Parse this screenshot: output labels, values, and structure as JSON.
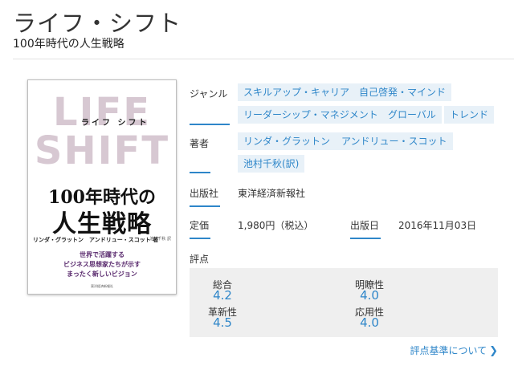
{
  "header": {
    "title": "ライフ・シフト",
    "subtitle": "100年時代の人生戦略"
  },
  "cover": {
    "big_line1": "LIFE",
    "big_line2": "SHIFT",
    "small_title": "ライフ シフト",
    "main_line1": "100年時代の",
    "main_line2": "人生戦略",
    "authors": "リンダ・グラットン　アンドリュー・スコット 著",
    "translator": "池村千秋 訳",
    "tagline1": "世界で活躍する",
    "tagline2": "ビジネス思想家たちが示す",
    "tagline3": "まったく新しいビジョン",
    "publisher_mark": "東洋経済新報社"
  },
  "details": {
    "genre_label": "ジャンル",
    "genres": [
      "スキルアップ・キャリア",
      "自己啓発・マインド",
      "リーダーシップ・マネジメント",
      "グローバル",
      "トレンド"
    ],
    "author_label": "著者",
    "authors": [
      "リンダ・グラットン",
      "アンドリュー・スコット",
      "池村千秋(訳)"
    ],
    "publisher_label": "出版社",
    "publisher": "東洋経済新報社",
    "price_label": "定価",
    "price": "1,980円（税込）",
    "date_label": "出版日",
    "date": "2016年11月03日"
  },
  "ratings": {
    "label": "評点",
    "overall_label": "総合",
    "overall": "4.2",
    "clarity_label": "明瞭性",
    "clarity": "4.0",
    "innovation_label": "革新性",
    "innovation": "4.5",
    "applicability_label": "応用性",
    "applicability": "4.0",
    "criteria_link": "評点基準について"
  },
  "colors": {
    "accent": "#2e86c9",
    "chip_bg": "#e8f1f8",
    "rating_bg": "#efefef"
  }
}
